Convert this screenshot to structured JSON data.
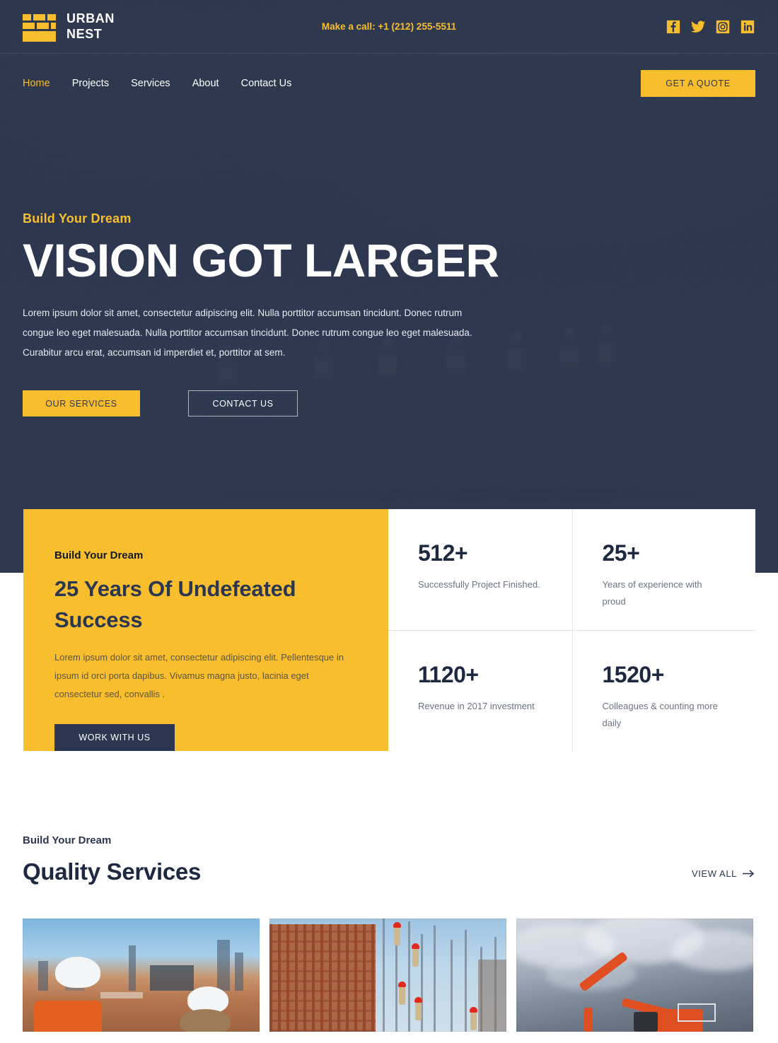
{
  "brand": {
    "name_line1": "URBAN",
    "name_line2": "NEST",
    "logo_icon": "brick-wall-icon"
  },
  "topbar": {
    "call_text": "Make a call: +1 (212) 255-5511",
    "socials": [
      {
        "name": "facebook-icon",
        "label": "Facebook"
      },
      {
        "name": "twitter-icon",
        "label": "Twitter"
      },
      {
        "name": "instagram-icon",
        "label": "Instagram"
      },
      {
        "name": "linkedin-icon",
        "label": "LinkedIn"
      }
    ]
  },
  "nav": {
    "items": [
      {
        "label": "Home",
        "active": true
      },
      {
        "label": "Projects",
        "active": false
      },
      {
        "label": "Services",
        "active": false
      },
      {
        "label": "About",
        "active": false
      },
      {
        "label": "Contact Us",
        "active": false
      }
    ],
    "cta_label": "GET A QUOTE"
  },
  "hero": {
    "eyebrow": "Build Your Dream",
    "title": "VISION GOT LARGER",
    "description": "Lorem ipsum dolor sit amet, consectetur adipiscing elit. Nulla porttitor accumsan tincidunt. Donec rutrum congue leo eget malesuada. Nulla porttitor accumsan tincidunt. Donec rutrum congue leo eget malesuada. Curabitur arcu erat, accumsan id imperdiet et, porttitor at sem.",
    "primary_button": "OUR SERVICES",
    "secondary_button": "CONTACT US"
  },
  "stats_panel": {
    "eyebrow": "Build Your Dream",
    "heading": "25 Years Of Undefeated Success",
    "paragraph": "Lorem ipsum dolor sit amet, consectetur adipiscing elit. Pellentesque in ipsum id orci porta dapibus. Vivamus magna justo, lacinia eget consectetur sed, convallis .",
    "button_label": "WORK WITH US",
    "stats": [
      {
        "value": "512+",
        "label": "Successfully Project Finished."
      },
      {
        "value": "25+",
        "label": "Years of experience with proud"
      },
      {
        "value": "1120+",
        "label": "Revenue in 2017 investment"
      },
      {
        "value": "1520+",
        "label": "Colleagues & counting more daily"
      }
    ]
  },
  "services": {
    "eyebrow": "Build Your Dream",
    "title": "Quality Services",
    "view_all_label": "VIEW ALL",
    "view_all_icon": "arrow-right-icon",
    "cards": [
      {
        "alt": "Engineers in white hard hats surveying a construction site"
      },
      {
        "alt": "Workers on rebar framework of a high-rise under construction"
      },
      {
        "alt": "Orange excavator against a dramatic stormy sky"
      }
    ]
  },
  "colors": {
    "accent": "#F9BE2E",
    "navy": "#2B3750",
    "dark_text": "#1d2841",
    "muted_text": "#6d7381"
  }
}
